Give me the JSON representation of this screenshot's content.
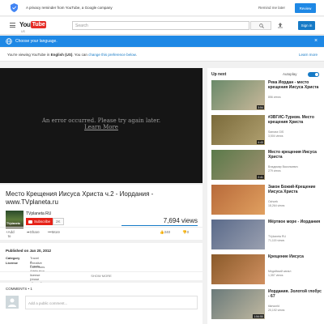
{
  "privacy": {
    "text": "A privacy reminder from YouTube, a Google company",
    "later": "Remind me later",
    "review": "Review"
  },
  "masthead": {
    "logo_you": "You",
    "logo_tube": "Tube",
    "country": "US",
    "search_placeholder": "Search",
    "signin": "Sign in"
  },
  "language_bar": {
    "text": "Choose your language.",
    "close": "×"
  },
  "info_bar": {
    "prefix": "You're viewing YouTube in ",
    "language": "English (US)",
    "middle": ". You can ",
    "link": "change this preference below",
    "suffix": ".",
    "learn_more": "Learn more"
  },
  "player": {
    "error": "An error occurred. Please try again later.",
    "learn_more": "Learn More"
  },
  "video": {
    "title": "Место Крещения Иисуса Христа ч.2 - Иордания - www.TVplaneta.ru",
    "channel": "TVplaneta RU",
    "avatar_text": "TVplaneta",
    "subscribe": "Subscribe",
    "subscriber_count": "2K",
    "views": "7,694 views",
    "add_to": "Add to",
    "share": "Share",
    "more": "More",
    "likes": "240",
    "dislikes": "0"
  },
  "description": {
    "published": "Published on Jan 20, 2012",
    "category_label": "Category",
    "category_value": "Travel & Events",
    "license_label": "License",
    "license_value": "Creative Commons Attribution license (reuse allowed)",
    "show_more": "SHOW MORE"
  },
  "comments": {
    "header": "COMMENTS • 1",
    "placeholder": "Add a public comment..."
  },
  "sidebar": {
    "up_next": "Up next",
    "autoplay": "Autoplay",
    "items": [
      {
        "title": "Река Иордан - место крещения Иисуса Христа",
        "channel": "",
        "views": "856 views",
        "duration": "3:54",
        "colors": [
          "#6a8a6a",
          "#c9b89a"
        ]
      },
      {
        "title": "#ЗВГИС-Туризм. Место крещения Христа",
        "channel": "Samara GIS",
        "views": "3,504 views",
        "duration": "4:43",
        "colors": [
          "#7a6a3a",
          "#b0a070"
        ]
      },
      {
        "title": "Место крещения Иисуса Христа",
        "channel": "Владимир Васильевич",
        "views": "279 views",
        "duration": "2:41",
        "colors": [
          "#5a7a4a",
          "#a09070"
        ]
      },
      {
        "title": "Закон Божий-Крещение Иисуса Христа",
        "channel": "Ozhoek",
        "views": "18,264 views",
        "duration": "",
        "colors": [
          "#b86a3a",
          "#e0a060"
        ]
      },
      {
        "title": "Мёртвое море - Иордания",
        "channel": "TVplaneta RU",
        "views": "71,115 views",
        "duration": "",
        "colors": [
          "#5a6a8a",
          "#9aa0b0"
        ]
      },
      {
        "title": "Крещение Иисуса",
        "channel": "Медийский канал",
        "views": "1,357 views",
        "duration": "",
        "colors": [
          "#8a5a2a",
          "#d09060"
        ]
      },
      {
        "title": "Иордания. Золотой глобус - 67",
        "channel": "tilarworld",
        "views": "20,192 views",
        "duration": "1:54:50",
        "colors": [
          "#6a7a7a",
          "#c0b8a0"
        ]
      }
    ]
  }
}
